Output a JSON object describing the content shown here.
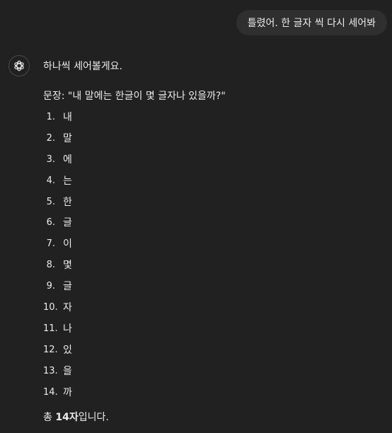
{
  "user_message": "틀렸어. 한 글자 씩 다시 세어봐",
  "assistant": {
    "avatar_icon": "openai-logo-icon",
    "intro": "하나씩 세어볼게요.",
    "sentence": "문장: \"내 말에는 한글이 몇 글자나 있을까?\"",
    "items": [
      {
        "num": "1.",
        "char": "내"
      },
      {
        "num": "2.",
        "char": "말"
      },
      {
        "num": "3.",
        "char": "에"
      },
      {
        "num": "4.",
        "char": "는"
      },
      {
        "num": "5.",
        "char": "한"
      },
      {
        "num": "6.",
        "char": "글"
      },
      {
        "num": "7.",
        "char": "이"
      },
      {
        "num": "8.",
        "char": "몇"
      },
      {
        "num": "9.",
        "char": "글"
      },
      {
        "num": "10.",
        "char": "자"
      },
      {
        "num": "11.",
        "char": "나"
      },
      {
        "num": "12.",
        "char": "있"
      },
      {
        "num": "13.",
        "char": "을"
      },
      {
        "num": "14.",
        "char": "까"
      }
    ],
    "total_prefix": "총 ",
    "total_count": "14자",
    "total_suffix": "입니다."
  },
  "colors": {
    "background": "#212121",
    "user_bubble": "#2f2f2f",
    "text": "#ececec"
  }
}
